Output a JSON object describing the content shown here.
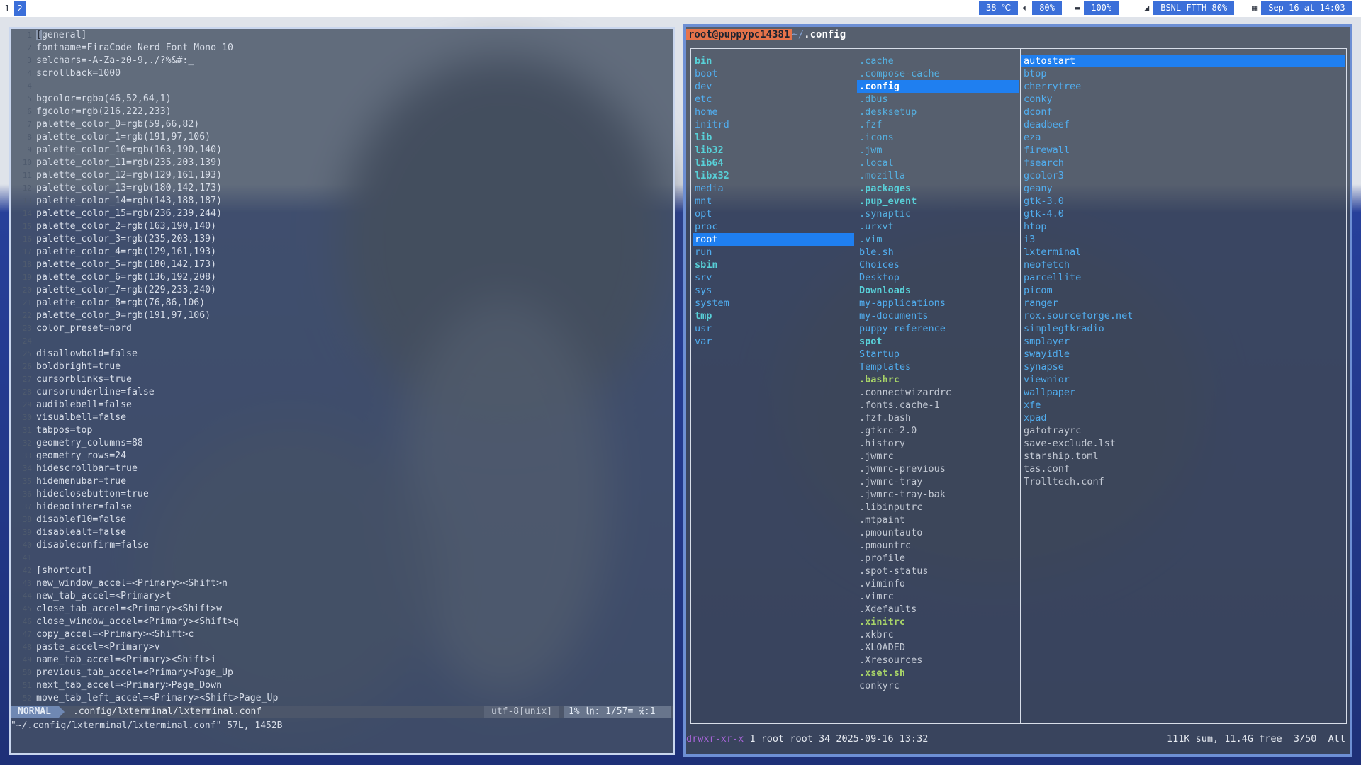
{
  "topbar": {
    "workspaces": [
      "1",
      "2"
    ],
    "active_workspace": "2",
    "temperature": "38 ℃",
    "volume": "80%",
    "battery": "100%",
    "network": "BSNL FTTH 80%",
    "datetime": "Sep 16 at 14:03"
  },
  "vim": {
    "lines": [
      {
        "n": "1",
        "t": "[general]"
      },
      {
        "n": "2",
        "t": "fontname=FiraCode Nerd Font Mono 10"
      },
      {
        "n": "3",
        "t": "selchars=-A-Za-z0-9,./?%&#:_"
      },
      {
        "n": "4",
        "t": "scrollback=1000"
      },
      {
        "n": "4",
        "t": ""
      },
      {
        "n": "5",
        "t": "bgcolor=rgba(46,52,64,1)"
      },
      {
        "n": "6",
        "t": "fgcolor=rgb(216,222,233)"
      },
      {
        "n": "7",
        "t": "palette_color_0=rgb(59,66,82)"
      },
      {
        "n": "8",
        "t": "palette_color_1=rgb(191,97,106)"
      },
      {
        "n": "9",
        "t": "palette_color_10=rgb(163,190,140)"
      },
      {
        "n": "10",
        "t": "palette_color_11=rgb(235,203,139)"
      },
      {
        "n": "11",
        "t": "palette_color_12=rgb(129,161,193)"
      },
      {
        "n": "12",
        "t": "palette_color_13=rgb(180,142,173)"
      },
      {
        "n": "13",
        "t": "palette_color_14=rgb(143,188,187)"
      },
      {
        "n": "14",
        "t": "palette_color_15=rgb(236,239,244)"
      },
      {
        "n": "15",
        "t": "palette_color_2=rgb(163,190,140)"
      },
      {
        "n": "16",
        "t": "palette_color_3=rgb(235,203,139)"
      },
      {
        "n": "17",
        "t": "palette_color_4=rgb(129,161,193)"
      },
      {
        "n": "18",
        "t": "palette_color_5=rgb(180,142,173)"
      },
      {
        "n": "19",
        "t": "palette_color_6=rgb(136,192,208)"
      },
      {
        "n": "20",
        "t": "palette_color_7=rgb(229,233,240)"
      },
      {
        "n": "21",
        "t": "palette_color_8=rgb(76,86,106)"
      },
      {
        "n": "22",
        "t": "palette_color_9=rgb(191,97,106)"
      },
      {
        "n": "23",
        "t": "color_preset=nord"
      },
      {
        "n": "24",
        "t": ""
      },
      {
        "n": "25",
        "t": "disallowbold=false"
      },
      {
        "n": "26",
        "t": "boldbright=true"
      },
      {
        "n": "27",
        "t": "cursorblinks=true"
      },
      {
        "n": "28",
        "t": "cursorunderline=false"
      },
      {
        "n": "29",
        "t": "audiblebell=false"
      },
      {
        "n": "30",
        "t": "visualbell=false"
      },
      {
        "n": "31",
        "t": "tabpos=top"
      },
      {
        "n": "32",
        "t": "geometry_columns=88"
      },
      {
        "n": "33",
        "t": "geometry_rows=24"
      },
      {
        "n": "34",
        "t": "hidescrollbar=true"
      },
      {
        "n": "35",
        "t": "hidemenubar=true"
      },
      {
        "n": "36",
        "t": "hideclosebutton=true"
      },
      {
        "n": "37",
        "t": "hidepointer=false"
      },
      {
        "n": "38",
        "t": "disablef10=false"
      },
      {
        "n": "39",
        "t": "disablealt=false"
      },
      {
        "n": "40",
        "t": "disableconfirm=false"
      },
      {
        "n": "41",
        "t": ""
      },
      {
        "n": "42",
        "t": "[shortcut]"
      },
      {
        "n": "43",
        "t": "new_window_accel=<Primary><Shift>n"
      },
      {
        "n": "44",
        "t": "new_tab_accel=<Primary>t"
      },
      {
        "n": "45",
        "t": "close_tab_accel=<Primary><Shift>w"
      },
      {
        "n": "46",
        "t": "close_window_accel=<Primary><Shift>q"
      },
      {
        "n": "47",
        "t": "copy_accel=<Primary><Shift>c"
      },
      {
        "n": "48",
        "t": "paste_accel=<Primary>v"
      },
      {
        "n": "49",
        "t": "name_tab_accel=<Primary><Shift>i"
      },
      {
        "n": "50",
        "t": "previous_tab_accel=<Primary>Page_Up"
      },
      {
        "n": "51",
        "t": "next_tab_accel=<Primary>Page_Down"
      },
      {
        "n": "52",
        "t": "move_tab_left_accel=<Primary><Shift>Page_Up"
      }
    ],
    "status": {
      "mode": "NORMAL",
      "file": ".config/lxterminal/lxterminal.conf",
      "encoding": "utf-8[unix]",
      "position": "1% ㏑: 1/57≡ ℅:1"
    },
    "cmdline": "\"~/.config/lxterminal/lxterminal.conf\" 57L, 1452B"
  },
  "ranger": {
    "user": "root@puppypc14381",
    "tilde": "~/",
    "path": ".config",
    "col1": [
      {
        "name": "bin",
        "k": "bold"
      },
      {
        "name": "boot",
        "k": "dir"
      },
      {
        "name": "dev",
        "k": "dir"
      },
      {
        "name": "etc",
        "k": "dir"
      },
      {
        "name": "home",
        "k": "dir"
      },
      {
        "name": "initrd",
        "k": "dir"
      },
      {
        "name": "lib",
        "k": "bold"
      },
      {
        "name": "lib32",
        "k": "bold"
      },
      {
        "name": "lib64",
        "k": "bold"
      },
      {
        "name": "libx32",
        "k": "bold"
      },
      {
        "name": "media",
        "k": "dir"
      },
      {
        "name": "mnt",
        "k": "dir"
      },
      {
        "name": "opt",
        "k": "dir"
      },
      {
        "name": "proc",
        "k": "dir"
      },
      {
        "name": "root",
        "k": "sel"
      },
      {
        "name": "run",
        "k": "dir"
      },
      {
        "name": "sbin",
        "k": "bold"
      },
      {
        "name": "srv",
        "k": "dir"
      },
      {
        "name": "sys",
        "k": "dir"
      },
      {
        "name": "system",
        "k": "dir"
      },
      {
        "name": "tmp",
        "k": "bold"
      },
      {
        "name": "usr",
        "k": "dir"
      },
      {
        "name": "var",
        "k": "dir"
      }
    ],
    "col2": [
      {
        "name": ".cache",
        "k": "hidden"
      },
      {
        "name": ".compose-cache",
        "k": "hidden"
      },
      {
        "name": ".config",
        "k": "selbold"
      },
      {
        "name": ".dbus",
        "k": "hidden"
      },
      {
        "name": ".desksetup",
        "k": "hidden"
      },
      {
        "name": ".fzf",
        "k": "hidden"
      },
      {
        "name": ".icons",
        "k": "hidden"
      },
      {
        "name": ".jwm",
        "k": "hidden"
      },
      {
        "name": ".local",
        "k": "hidden"
      },
      {
        "name": ".mozilla",
        "k": "hidden"
      },
      {
        "name": ".packages",
        "k": "bold"
      },
      {
        "name": ".pup_event",
        "k": "bold"
      },
      {
        "name": ".synaptic",
        "k": "hidden"
      },
      {
        "name": ".urxvt",
        "k": "hidden"
      },
      {
        "name": ".vim",
        "k": "hidden"
      },
      {
        "name": "ble.sh",
        "k": "dir"
      },
      {
        "name": "Choices",
        "k": "dir"
      },
      {
        "name": "Desktop",
        "k": "dir"
      },
      {
        "name": "Downloads",
        "k": "bold"
      },
      {
        "name": "my-applications",
        "k": "dir"
      },
      {
        "name": "my-documents",
        "k": "dir"
      },
      {
        "name": "puppy-reference",
        "k": "dir"
      },
      {
        "name": "spot",
        "k": "bold"
      },
      {
        "name": "Startup",
        "k": "dir"
      },
      {
        "name": "Templates",
        "k": "dir"
      },
      {
        "name": ".bashrc",
        "k": "exec"
      },
      {
        "name": ".connectwizardrc",
        "k": "file"
      },
      {
        "name": ".fonts.cache-1",
        "k": "file"
      },
      {
        "name": ".fzf.bash",
        "k": "file"
      },
      {
        "name": ".gtkrc-2.0",
        "k": "file"
      },
      {
        "name": ".history",
        "k": "file"
      },
      {
        "name": ".jwmrc",
        "k": "file"
      },
      {
        "name": ".jwmrc-previous",
        "k": "file"
      },
      {
        "name": ".jwmrc-tray",
        "k": "file"
      },
      {
        "name": ".jwmrc-tray-bak",
        "k": "file"
      },
      {
        "name": ".libinputrc",
        "k": "file"
      },
      {
        "name": ".mtpaint",
        "k": "file"
      },
      {
        "name": ".pmountauto",
        "k": "file"
      },
      {
        "name": ".pmountrc",
        "k": "file"
      },
      {
        "name": ".profile",
        "k": "file"
      },
      {
        "name": ".spot-status",
        "k": "file"
      },
      {
        "name": ".viminfo",
        "k": "file"
      },
      {
        "name": ".vimrc",
        "k": "file"
      },
      {
        "name": ".Xdefaults",
        "k": "file"
      },
      {
        "name": ".xinitrc",
        "k": "exec"
      },
      {
        "name": ".xkbrc",
        "k": "file"
      },
      {
        "name": ".XLOADED",
        "k": "file"
      },
      {
        "name": ".Xresources",
        "k": "file"
      },
      {
        "name": ".xset.sh",
        "k": "exec"
      },
      {
        "name": "conkyrc",
        "k": "file"
      }
    ],
    "col3": [
      {
        "name": "autostart",
        "k": "sel"
      },
      {
        "name": "btop",
        "k": "dir"
      },
      {
        "name": "cherrytree",
        "k": "dir"
      },
      {
        "name": "conky",
        "k": "dir"
      },
      {
        "name": "dconf",
        "k": "dir"
      },
      {
        "name": "deadbeef",
        "k": "dir"
      },
      {
        "name": "eza",
        "k": "dir"
      },
      {
        "name": "firewall",
        "k": "dir"
      },
      {
        "name": "fsearch",
        "k": "dir"
      },
      {
        "name": "gcolor3",
        "k": "dir"
      },
      {
        "name": "geany",
        "k": "dir"
      },
      {
        "name": "gtk-3.0",
        "k": "dir"
      },
      {
        "name": "gtk-4.0",
        "k": "dir"
      },
      {
        "name": "htop",
        "k": "dir"
      },
      {
        "name": "i3",
        "k": "dir"
      },
      {
        "name": "lxterminal",
        "k": "dir"
      },
      {
        "name": "neofetch",
        "k": "dir"
      },
      {
        "name": "parcellite",
        "k": "dir"
      },
      {
        "name": "picom",
        "k": "dir"
      },
      {
        "name": "ranger",
        "k": "dir"
      },
      {
        "name": "rox.sourceforge.net",
        "k": "dir"
      },
      {
        "name": "simplegtkradio",
        "k": "dir"
      },
      {
        "name": "smplayer",
        "k": "dir"
      },
      {
        "name": "swayidle",
        "k": "dir"
      },
      {
        "name": "synapse",
        "k": "dir"
      },
      {
        "name": "viewnior",
        "k": "dir"
      },
      {
        "name": "wallpaper",
        "k": "dir"
      },
      {
        "name": "xfe",
        "k": "dir"
      },
      {
        "name": "xpad",
        "k": "dir"
      },
      {
        "name": "gatotrayrc",
        "k": "file"
      },
      {
        "name": "save-exclude.lst",
        "k": "file"
      },
      {
        "name": "starship.toml",
        "k": "file"
      },
      {
        "name": "tas.conf",
        "k": "file"
      },
      {
        "name": "Trolltech.conf",
        "k": "file"
      }
    ],
    "status_left_perm": "drwxr-xr-x",
    "status_left_info": "1 root root 34 2025-09-16 13:32",
    "status_right": "111K sum, 11.4G free  3/50  All"
  }
}
